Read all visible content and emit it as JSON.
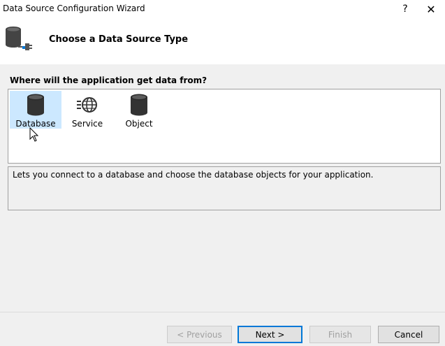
{
  "window": {
    "title": "Data Source Configuration Wizard",
    "help_label": "?",
    "close_label": "✕"
  },
  "header": {
    "title": "Choose a Data Source Type",
    "icon": "database-plug-icon"
  },
  "question": "Where will the application get data from?",
  "choices": [
    {
      "label": "Database",
      "icon": "database-icon",
      "selected": true
    },
    {
      "label": "Service",
      "icon": "service-globe-icon",
      "selected": false
    },
    {
      "label": "Object",
      "icon": "object-cylinder-icon",
      "selected": false
    }
  ],
  "description": "Lets you connect to a database and choose the database objects for your application.",
  "buttons": {
    "previous": "< Previous",
    "next": "Next >",
    "finish": "Finish",
    "cancel": "Cancel"
  },
  "colors": {
    "selection": "#cce8ff",
    "accent": "#0078d7"
  }
}
